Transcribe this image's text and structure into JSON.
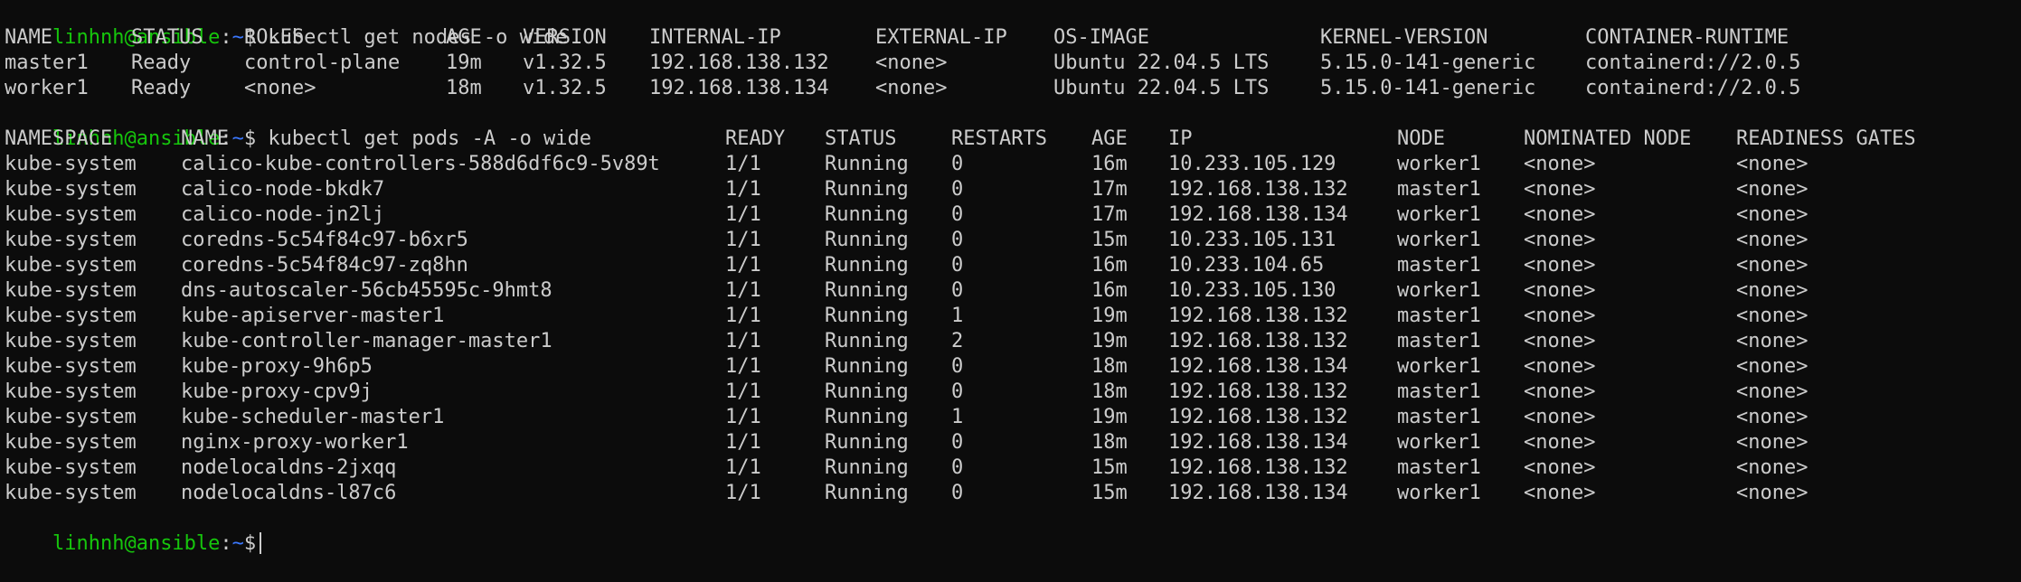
{
  "prompt": {
    "user_host": "linhnh@ansible",
    "separator": ":",
    "path": "~",
    "symbol": "$"
  },
  "commands": [
    "kubectl get nodes -o wide",
    "kubectl get pods -A -o wide"
  ],
  "nodes": {
    "headers": [
      "NAME",
      "STATUS",
      "ROLES",
      "AGE",
      "VERSION",
      "INTERNAL-IP",
      "EXTERNAL-IP",
      "OS-IMAGE",
      "KERNEL-VERSION",
      "CONTAINER-RUNTIME"
    ],
    "rows": [
      [
        "master1",
        "Ready",
        "control-plane",
        "19m",
        "v1.32.5",
        "192.168.138.132",
        "<none>",
        "Ubuntu 22.04.5 LTS",
        "5.15.0-141-generic",
        "containerd://2.0.5"
      ],
      [
        "worker1",
        "Ready",
        "<none>",
        "18m",
        "v1.32.5",
        "192.168.138.134",
        "<none>",
        "Ubuntu 22.04.5 LTS",
        "5.15.0-141-generic",
        "containerd://2.0.5"
      ]
    ]
  },
  "pods": {
    "headers": [
      "NAMESPACE",
      "NAME",
      "READY",
      "STATUS",
      "RESTARTS",
      "AGE",
      "IP",
      "NODE",
      "NOMINATED NODE",
      "READINESS GATES"
    ],
    "rows": [
      [
        "kube-system",
        "calico-kube-controllers-588d6df6c9-5v89t",
        "1/1",
        "Running",
        "0",
        "16m",
        "10.233.105.129",
        "worker1",
        "<none>",
        "<none>"
      ],
      [
        "kube-system",
        "calico-node-bkdk7",
        "1/1",
        "Running",
        "0",
        "17m",
        "192.168.138.132",
        "master1",
        "<none>",
        "<none>"
      ],
      [
        "kube-system",
        "calico-node-jn2lj",
        "1/1",
        "Running",
        "0",
        "17m",
        "192.168.138.134",
        "worker1",
        "<none>",
        "<none>"
      ],
      [
        "kube-system",
        "coredns-5c54f84c97-b6xr5",
        "1/1",
        "Running",
        "0",
        "15m",
        "10.233.105.131",
        "worker1",
        "<none>",
        "<none>"
      ],
      [
        "kube-system",
        "coredns-5c54f84c97-zq8hn",
        "1/1",
        "Running",
        "0",
        "16m",
        "10.233.104.65",
        "master1",
        "<none>",
        "<none>"
      ],
      [
        "kube-system",
        "dns-autoscaler-56cb45595c-9hmt8",
        "1/1",
        "Running",
        "0",
        "16m",
        "10.233.105.130",
        "worker1",
        "<none>",
        "<none>"
      ],
      [
        "kube-system",
        "kube-apiserver-master1",
        "1/1",
        "Running",
        "1",
        "19m",
        "192.168.138.132",
        "master1",
        "<none>",
        "<none>"
      ],
      [
        "kube-system",
        "kube-controller-manager-master1",
        "1/1",
        "Running",
        "2",
        "19m",
        "192.168.138.132",
        "master1",
        "<none>",
        "<none>"
      ],
      [
        "kube-system",
        "kube-proxy-9h6p5",
        "1/1",
        "Running",
        "0",
        "18m",
        "192.168.138.134",
        "worker1",
        "<none>",
        "<none>"
      ],
      [
        "kube-system",
        "kube-proxy-cpv9j",
        "1/1",
        "Running",
        "0",
        "18m",
        "192.168.138.132",
        "master1",
        "<none>",
        "<none>"
      ],
      [
        "kube-system",
        "kube-scheduler-master1",
        "1/1",
        "Running",
        "1",
        "19m",
        "192.168.138.132",
        "master1",
        "<none>",
        "<none>"
      ],
      [
        "kube-system",
        "nginx-proxy-worker1",
        "1/1",
        "Running",
        "0",
        "18m",
        "192.168.138.134",
        "worker1",
        "<none>",
        "<none>"
      ],
      [
        "kube-system",
        "nodelocaldns-2jxqq",
        "1/1",
        "Running",
        "0",
        "15m",
        "192.168.138.132",
        "master1",
        "<none>",
        "<none>"
      ],
      [
        "kube-system",
        "nodelocaldns-l87c6",
        "1/1",
        "Running",
        "0",
        "15m",
        "192.168.138.134",
        "worker1",
        "<none>",
        "<none>"
      ]
    ]
  },
  "colors": {
    "background": "#0c0c0c",
    "foreground": "#cccccc",
    "prompt_user": "#16c60c",
    "prompt_path": "#3b78ff"
  }
}
